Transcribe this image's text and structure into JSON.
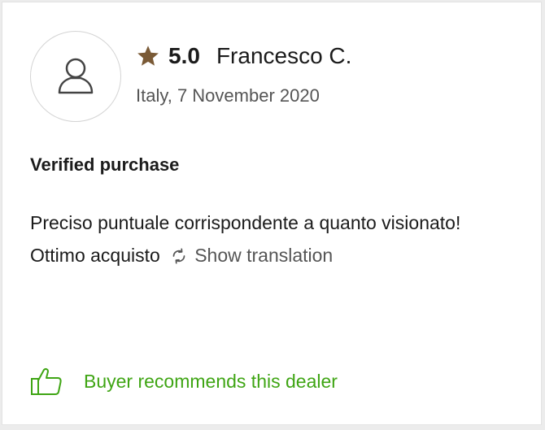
{
  "review": {
    "rating": "5.0",
    "reviewer_name": "Francesco C.",
    "meta": "Italy, 7 November 2020",
    "verified_label": "Verified purchase",
    "text": "Preciso puntuale corrispondente a quanto visionato! Ottimo acquisto",
    "translate_label": "Show translation",
    "recommend_label": "Buyer recommends this dealer"
  },
  "icons": {
    "avatar": "user-icon",
    "star": "star-icon",
    "translate": "refresh-arrows-icon",
    "recommend": "thumbs-up-icon"
  },
  "colors": {
    "star": "#7a5a36",
    "recommend": "#3fa514",
    "text_primary": "#1b1b1b",
    "text_secondary": "#555555"
  }
}
